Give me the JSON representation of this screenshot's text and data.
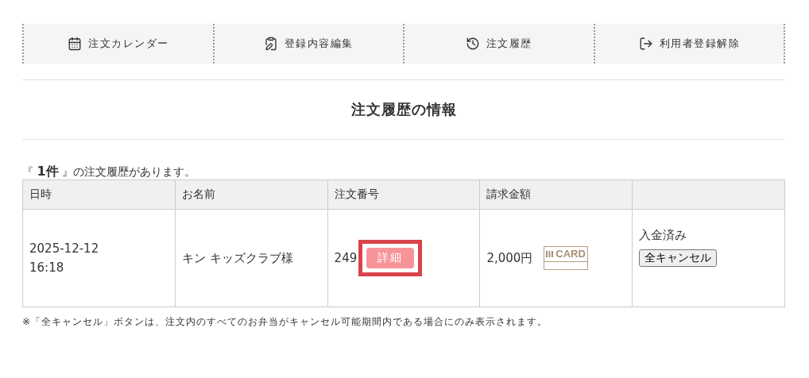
{
  "nav": [
    {
      "label": "注文カレンダー",
      "kind": "calendar"
    },
    {
      "label": "登録内容編集",
      "kind": "edit"
    },
    {
      "label": "注文履歴",
      "kind": "history"
    },
    {
      "label": "利用者登録解除",
      "kind": "logout"
    }
  ],
  "title": "注文履歴の情報",
  "summary": "『 **1件** 』の注文履歴があります。",
  "table": {
    "columns": [
      "日時",
      "お名前",
      "注文番号",
      "請求金額"
    ],
    "rows": [
      {
        "date": "2025-12-12",
        "time": "16:18",
        "name": "キン キッズクラブ様",
        "order_no": "249",
        "detail_button": "詳細",
        "detail_highlighted": true,
        "amount": "2,000円",
        "payment_badge": "CARD",
        "status": "入金済み",
        "cancel_button": "全キャンセル"
      }
    ]
  },
  "footnote": "※「全キャンセル」ボタンは、注文内のすべてのお弁当がキャンセル可能期間内である場合にのみ表示されます。"
}
